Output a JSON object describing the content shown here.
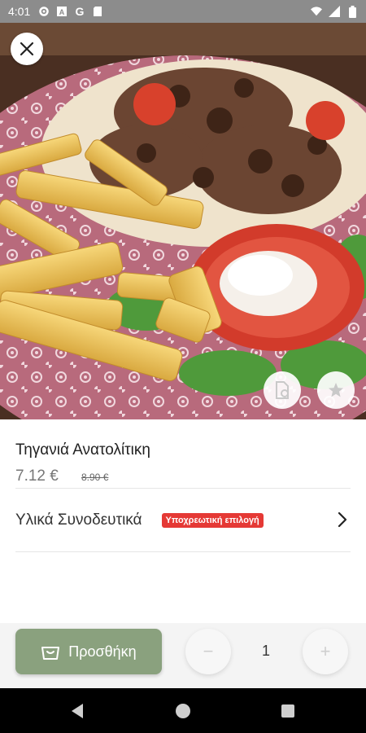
{
  "status_bar": {
    "time": "4:01",
    "left_icons": [
      "gear-icon",
      "a-box-icon",
      "g-letter-icon",
      "sd-card-icon"
    ],
    "right_icons": [
      "wifi-icon",
      "signal-icon",
      "battery-icon"
    ]
  },
  "hero": {
    "image_description_icon": "food-photo",
    "close_icon": "close-icon",
    "menu_icon": "menu-doc-icon",
    "favorite_icon": "star-icon"
  },
  "product": {
    "name": "Τηγανιά Ανατολίτικη",
    "price": "7.12 €",
    "old_price": "8.90 €"
  },
  "extras": {
    "label": "Υλικά Συνοδευτικά",
    "badge": "Υποχρεωτική επιλογή"
  },
  "action_bar": {
    "add_label": "Προσθήκη",
    "minus_label": "−",
    "plus_label": "+",
    "quantity": "1"
  },
  "colors": {
    "accent": "#8aa17e",
    "badge": "#e53935",
    "status_bar": "#8c8c8c"
  }
}
